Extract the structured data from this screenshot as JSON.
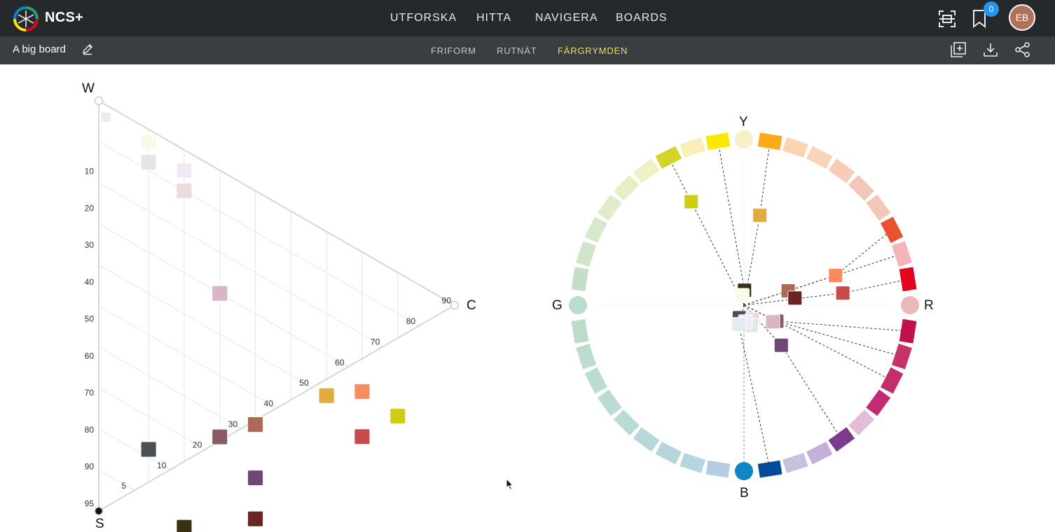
{
  "app": {
    "name": "NCS+"
  },
  "nav": {
    "items": [
      "UTFORSKA",
      "HITTA",
      "NAVIGERA",
      "BOARDS"
    ]
  },
  "header": {
    "bookmark_count": "0",
    "avatar_initials": "EB"
  },
  "board": {
    "title": "A big board"
  },
  "subtabs": {
    "items": [
      "FRIFORM",
      "RUTNÄT",
      "FÄRGRYMDEN"
    ],
    "active": "FÄRGRYMDEN"
  },
  "triangle": {
    "corner_w": "W",
    "corner_c": "C",
    "corner_s": "S",
    "w_ticks": [
      "10",
      "20",
      "30",
      "40",
      "50",
      "60",
      "70",
      "80",
      "90",
      "95"
    ],
    "c_ticks": [
      "5",
      "10",
      "20",
      "30",
      "40",
      "50",
      "60",
      "70",
      "80",
      "90"
    ],
    "swatches": [
      {
        "b": 3,
        "c": 2,
        "color": "#ebebeb"
      },
      {
        "b": 3,
        "c": 14,
        "color": "#fafae8"
      },
      {
        "b": 8,
        "c": 14,
        "color": "#e6e5e6"
      },
      {
        "b": 5,
        "c": 24,
        "color": "#f1e9f5"
      },
      {
        "b": 10,
        "c": 24,
        "color": "#ecdcdc"
      },
      {
        "b": 30,
        "c": 34,
        "color": "#d9b5c5"
      },
      {
        "b": 34,
        "c": 74,
        "color": "#fa8a5f"
      },
      {
        "b": 40,
        "c": 64,
        "color": "#e2ab3f"
      },
      {
        "b": 35,
        "c": 84,
        "color": "#cfcd12"
      },
      {
        "b": 45,
        "c": 74,
        "color": "#c54c48"
      },
      {
        "b": 57,
        "c": 44,
        "color": "#ab6a55"
      },
      {
        "b": 65,
        "c": 34,
        "color": "#8a5a62"
      },
      {
        "b": 70,
        "c": 44,
        "color": "#6e4777"
      },
      {
        "b": 80,
        "c": 44,
        "color": "#6b2424"
      },
      {
        "b": 78,
        "c": 14,
        "color": "#4a5054"
      },
      {
        "b": 92,
        "c": 24,
        "color": "#3a3115"
      }
    ]
  },
  "hue_circle": {
    "label_y": "Y",
    "label_r": "R",
    "label_b": "B",
    "label_g": "G",
    "segments": [
      {
        "angle": 9,
        "color": "#fcaa17"
      },
      {
        "angle": 18,
        "color": "#fad3b0"
      },
      {
        "angle": 27,
        "color": "#f8d5b8"
      },
      {
        "angle": 36,
        "color": "#f6ccb6"
      },
      {
        "angle": 45,
        "color": "#f4c6b6"
      },
      {
        "angle": 54,
        "color": "#f3c6b8"
      },
      {
        "angle": 63,
        "color": "#e9522e"
      },
      {
        "angle": 72,
        "color": "#f5b5b8"
      },
      {
        "angle": 81,
        "color": "#e1061e"
      },
      {
        "angle": 99,
        "color": "#c20f4d"
      },
      {
        "angle": 108,
        "color": "#c63467"
      },
      {
        "angle": 117,
        "color": "#c22f6a"
      },
      {
        "angle": 126,
        "color": "#c22a71"
      },
      {
        "angle": 135,
        "color": "#e2bcd8"
      },
      {
        "angle": 144,
        "color": "#7a3b8c"
      },
      {
        "angle": 153,
        "color": "#c3b0d8"
      },
      {
        "angle": 162,
        "color": "#c7c1dd"
      },
      {
        "angle": 171,
        "color": "#034b98"
      },
      {
        "angle": 189,
        "color": "#b4cde0"
      },
      {
        "angle": 198,
        "color": "#b5d6dd"
      },
      {
        "angle": 207,
        "color": "#b6d6da"
      },
      {
        "angle": 216,
        "color": "#b7d7d8"
      },
      {
        "angle": 225,
        "color": "#b8dbd6"
      },
      {
        "angle": 234,
        "color": "#b9dcd5"
      },
      {
        "angle": 243,
        "color": "#badcd2"
      },
      {
        "angle": 252,
        "color": "#bbdccf"
      },
      {
        "angle": 261,
        "color": "#bcdcc9"
      },
      {
        "angle": 279,
        "color": "#c4dfc6"
      },
      {
        "angle": 288,
        "color": "#d2e5cb"
      },
      {
        "angle": 297,
        "color": "#d8e8cc"
      },
      {
        "angle": 306,
        "color": "#e0ecca"
      },
      {
        "angle": 315,
        "color": "#e5eec4"
      },
      {
        "angle": 324,
        "color": "#f0f0c4"
      },
      {
        "angle": 333,
        "color": "#d3d32a"
      },
      {
        "angle": 342,
        "color": "#f9efb9"
      },
      {
        "angle": 351,
        "color": "#fbea00"
      }
    ],
    "poles": [
      {
        "angle": 0,
        "color": "#faf0c8"
      },
      {
        "angle": 90,
        "color": "#ebb8bb"
      },
      {
        "angle": 180,
        "color": "#0f85c4"
      },
      {
        "angle": 270,
        "color": "#b9dccc"
      }
    ],
    "dots": [
      {
        "angle": 333,
        "r": 0.7,
        "color": "#cfcd12"
      },
      {
        "angle": 10,
        "r": 0.55,
        "color": "#e2ab3f"
      },
      {
        "angle": 72,
        "r": 0.58,
        "color": "#fa8a5f"
      },
      {
        "angle": 83,
        "r": 0.6,
        "color": "#c54c48"
      },
      {
        "angle": 72,
        "r": 0.28,
        "color": "#ab6a55"
      },
      {
        "angle": 82,
        "r": 0.31,
        "color": "#6b2424"
      },
      {
        "angle": 116,
        "r": 0.22,
        "color": "#8a5a62"
      },
      {
        "angle": 137,
        "r": 0.33,
        "color": "#6e4777"
      },
      {
        "angle": 120,
        "r": 0.2,
        "color": "#d9b5c5"
      },
      {
        "angle": 2,
        "r": 0.09,
        "color": "#3a3115"
      },
      {
        "angle": 350,
        "r": 0.06,
        "color": "#fafae8"
      },
      {
        "angle": 200,
        "r": 0.08,
        "color": "#4a5054"
      },
      {
        "angle": 150,
        "r": 0.1,
        "color": "#ecdcdc"
      },
      {
        "angle": 160,
        "r": 0.13,
        "color": "#e6e5e6"
      },
      {
        "angle": 175,
        "r": 0.1,
        "color": "#f1e9f5"
      },
      {
        "angle": 195,
        "r": 0.12,
        "color": "#e1ebf2"
      }
    ],
    "lines": [
      {
        "from": 0,
        "to_angle": 333
      },
      {
        "from": 1,
        "to_angle": 9
      },
      {
        "from": 2,
        "to_angle": 63
      },
      {
        "from": 3,
        "to_angle": 81
      },
      {
        "from": 6,
        "to_angle": 99
      },
      {
        "from": 6,
        "to_angle": 108
      },
      {
        "from": 6,
        "to_angle": 117
      },
      {
        "from": 7,
        "to_angle": 144
      },
      {
        "from": 9,
        "to_angle": 351
      },
      {
        "from": 15,
        "to_angle": 171
      },
      {
        "from": 4,
        "to_angle": 72
      }
    ]
  }
}
